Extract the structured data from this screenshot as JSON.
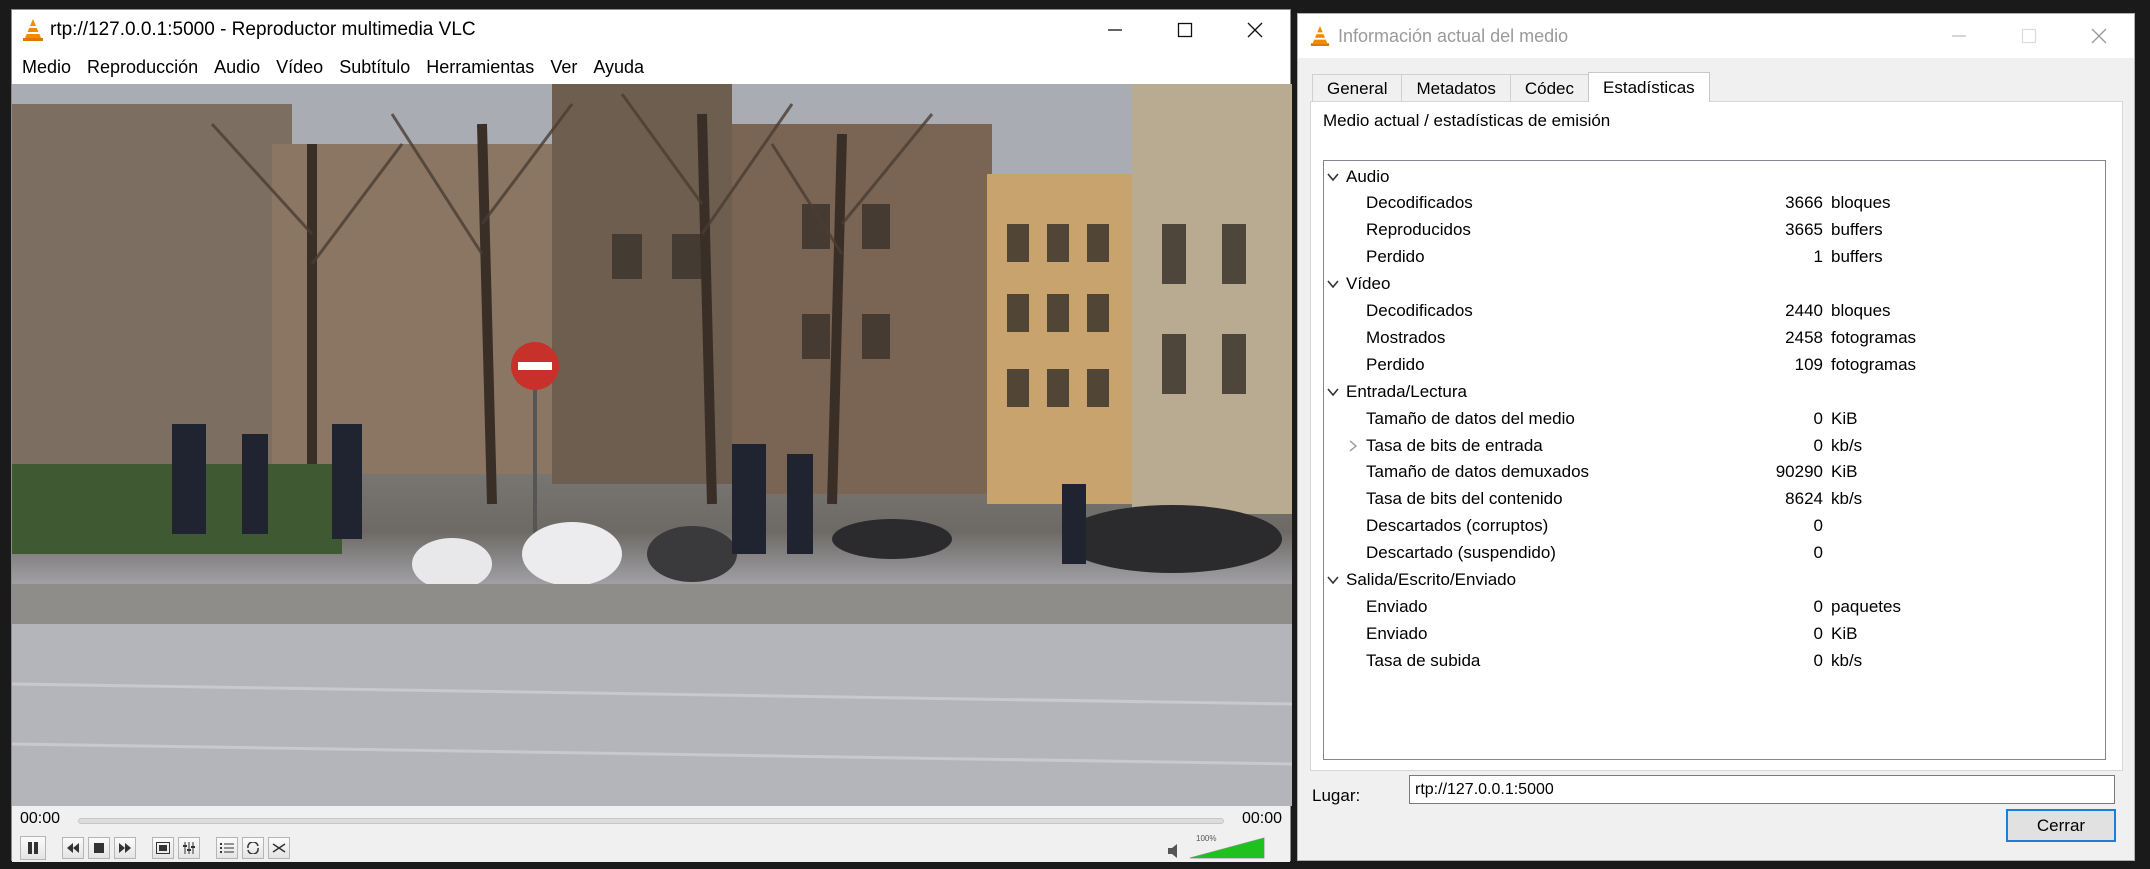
{
  "vlc": {
    "title": "rtp://127.0.0.1:5000 - Reproductor multimedia VLC",
    "menu": [
      "Medio",
      "Reproducción",
      "Audio",
      "Vídeo",
      "Subtítulo",
      "Herramientas",
      "Ver",
      "Ayuda"
    ],
    "time_elapsed": "00:00",
    "time_total": "00:00",
    "volume_percent": "100%",
    "volume_level": 1.0,
    "accent_color": "#1ec11e"
  },
  "info": {
    "title": "Información actual del medio",
    "tabs": [
      "General",
      "Metadatos",
      "Códec",
      "Estadísticas"
    ],
    "active_tab": "Estadísticas",
    "section_title": "Medio actual / estadísticas de emisión",
    "groups": [
      {
        "label": "Audio",
        "rows": [
          {
            "label": "Decodificados",
            "value": "3666",
            "unit": "bloques"
          },
          {
            "label": "Reproducidos",
            "value": "3665",
            "unit": "buffers"
          },
          {
            "label": "Perdido",
            "value": "1",
            "unit": "buffers"
          }
        ]
      },
      {
        "label": "Vídeo",
        "rows": [
          {
            "label": "Decodificados",
            "value": "2440",
            "unit": "bloques"
          },
          {
            "label": "Mostrados",
            "value": "2458",
            "unit": "fotogramas"
          },
          {
            "label": "Perdido",
            "value": "109",
            "unit": "fotogramas"
          }
        ]
      },
      {
        "label": "Entrada/Lectura",
        "rows": [
          {
            "label": "Tamaño de datos del medio",
            "value": "0",
            "unit": "KiB"
          },
          {
            "label": "Tasa de bits de entrada",
            "value": "0",
            "unit": "kb/s",
            "collapsed": true
          },
          {
            "label": "Tamaño de datos demuxados",
            "value": "90290",
            "unit": "KiB"
          },
          {
            "label": "Tasa de bits del contenido",
            "value": "8624",
            "unit": "kb/s"
          },
          {
            "label": "Descartados (corruptos)",
            "value": "0",
            "unit": ""
          },
          {
            "label": "Descartado (suspendido)",
            "value": "0",
            "unit": ""
          }
        ]
      },
      {
        "label": "Salida/Escrito/Enviado",
        "rows": [
          {
            "label": "Enviado",
            "value": "0",
            "unit": "paquetes"
          },
          {
            "label": "Enviado",
            "value": "0",
            "unit": "KiB"
          },
          {
            "label": "Tasa de subida",
            "value": "0",
            "unit": "kb/s"
          }
        ]
      }
    ],
    "place_label": "Lugar:",
    "place_value": "rtp://127.0.0.1:5000",
    "close_label": "Cerrar"
  }
}
